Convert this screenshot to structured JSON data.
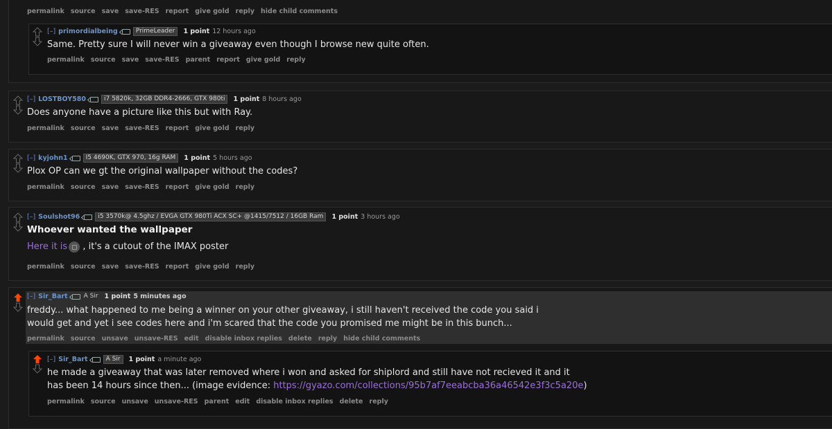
{
  "top_buttons": [
    "permalink",
    "source",
    "save",
    "save-RES",
    "report",
    "give gold",
    "reply",
    "hide child comments"
  ],
  "comments": [
    {
      "expand": "[–]",
      "author": "primordialbeing",
      "flair": "PrimeLeader",
      "score": "1 point",
      "time": "12 hours ago",
      "text": "Same. Pretty sure I will never win a giveaway even though I browse new quite often.",
      "buttons": [
        "permalink",
        "source",
        "save",
        "save-RES",
        "parent",
        "report",
        "give gold",
        "reply"
      ]
    },
    {
      "expand": "[–]",
      "author": "LOSTBOY580",
      "flair": "i7 5820k, 32GB DDR4-2666, GTX 980ti",
      "score": "1 point",
      "time": "8 hours ago",
      "text": "Does anyone have a picture like this but with Ray.",
      "buttons": [
        "permalink",
        "source",
        "save",
        "save-RES",
        "report",
        "give gold",
        "reply"
      ]
    },
    {
      "expand": "[–]",
      "author": "kyjohn1",
      "flair": "I5 4690K, GTX 970, 16g RAM",
      "score": "1 point",
      "time": "5 hours ago",
      "text": "Plox OP can we gt the original wallpaper without the codes?",
      "buttons": [
        "permalink",
        "source",
        "save",
        "save-RES",
        "report",
        "give gold",
        "reply"
      ]
    },
    {
      "expand": "[–]",
      "author": "Soulshot96",
      "flair": "i5 3570k@ 4.5ghz / EVGA GTX 980Ti ACX SC+ @1415/7512 / 16GB Ram",
      "score": "1 point",
      "time": "3 hours ago",
      "heading": "Whoever wanted the wallpaper",
      "link_text": "Here it is",
      "text_after": ", it's a cutout of the IMAX poster",
      "buttons": [
        "permalink",
        "source",
        "save",
        "save-RES",
        "report",
        "give gold",
        "reply"
      ]
    },
    {
      "expand": "[–]",
      "author": "Sir_Bart",
      "flair": "A Sir",
      "score": "1 point",
      "time": "5 minutes ago",
      "text_line1": "freddy... what happened to me being a winner on your other giveaway, i still haven't received the code you said i",
      "text_line2": "would get and yet i see codes here and i'm scared that the code you promised me might be in this bunch...",
      "buttons": [
        "permalink",
        "source",
        "unsave",
        "unsave-RES",
        "edit",
        "disable inbox replies",
        "delete",
        "reply",
        "hide child comments"
      ]
    },
    {
      "expand": "[–]",
      "author": "Sir_Bart",
      "flair": "A Sir",
      "score": "1 point",
      "time": "a minute ago",
      "text_line1": "he made a giveaway that was later removed where i won and asked for shiplord and still have not recieved it and it",
      "text_line2_prefix": "has been 14 hours since then... (image evidence: ",
      "text_line2_link": "https://gyazo.com/collections/95b7af7eeabcba36a46542e3f3c5a20e",
      "text_line2_suffix": ")",
      "buttons": [
        "permalink",
        "source",
        "unsave",
        "unsave-RES",
        "parent",
        "edit",
        "disable inbox replies",
        "delete",
        "reply"
      ]
    }
  ],
  "colors": {
    "background": "#1b1b1b",
    "author": "#6b93c9",
    "link": "#9b6fdb",
    "upvoted": "#ff4500"
  }
}
